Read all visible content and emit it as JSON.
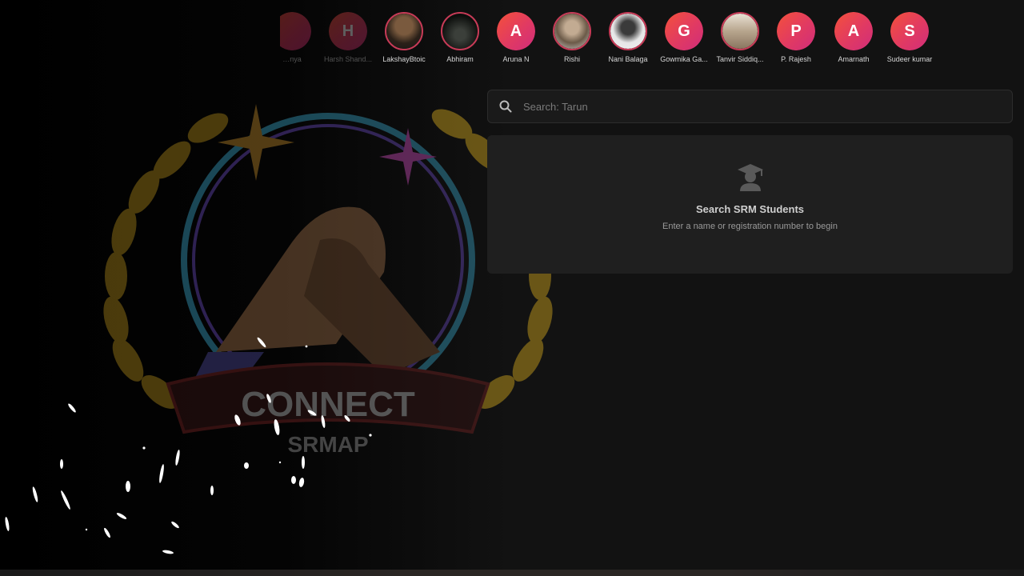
{
  "stories": [
    {
      "name": "…nya",
      "letter": "",
      "type": "letter",
      "faded": true
    },
    {
      "name": "Harsh Shand...",
      "letter": "H",
      "type": "letter",
      "faded": true
    },
    {
      "name": "LakshayBtoic",
      "letter": "",
      "type": "photo",
      "photo_color": "#3b2a1e"
    },
    {
      "name": "Abhiram",
      "letter": "",
      "type": "photo",
      "photo_color": "#0f1210"
    },
    {
      "name": "Aruna N",
      "letter": "A",
      "type": "letter"
    },
    {
      "name": "Rishi",
      "letter": "",
      "type": "photo",
      "photo_color": "#8c7a68"
    },
    {
      "name": "Nani Balaga",
      "letter": "",
      "type": "photo",
      "photo_color": "#d8d8d8"
    },
    {
      "name": "Gowmika Ga...",
      "letter": "G",
      "type": "letter"
    },
    {
      "name": "Tanvir Siddiq...",
      "letter": "",
      "type": "photo",
      "photo_color": "#c9b9a4"
    },
    {
      "name": "P. Rajesh",
      "letter": "P",
      "type": "letter"
    },
    {
      "name": "Amarnath",
      "letter": "A",
      "type": "letter"
    },
    {
      "name": "Sudeer kumar",
      "letter": "S",
      "type": "letter"
    }
  ],
  "search": {
    "placeholder": "Search: Tarun",
    "value": ""
  },
  "empty_state": {
    "icon": "graduate-icon",
    "title": "Search SRM Students",
    "subtitle": "Enter a name or registration number to begin"
  },
  "logo": {
    "line1": "CONNECT",
    "line2": "SRMAP"
  },
  "colors": {
    "accent_gradient_start": "#f4513a",
    "accent_gradient_end": "#d02d7b",
    "ring": "#c73b57",
    "background": "#121212",
    "panel": "#1f1f1f"
  }
}
